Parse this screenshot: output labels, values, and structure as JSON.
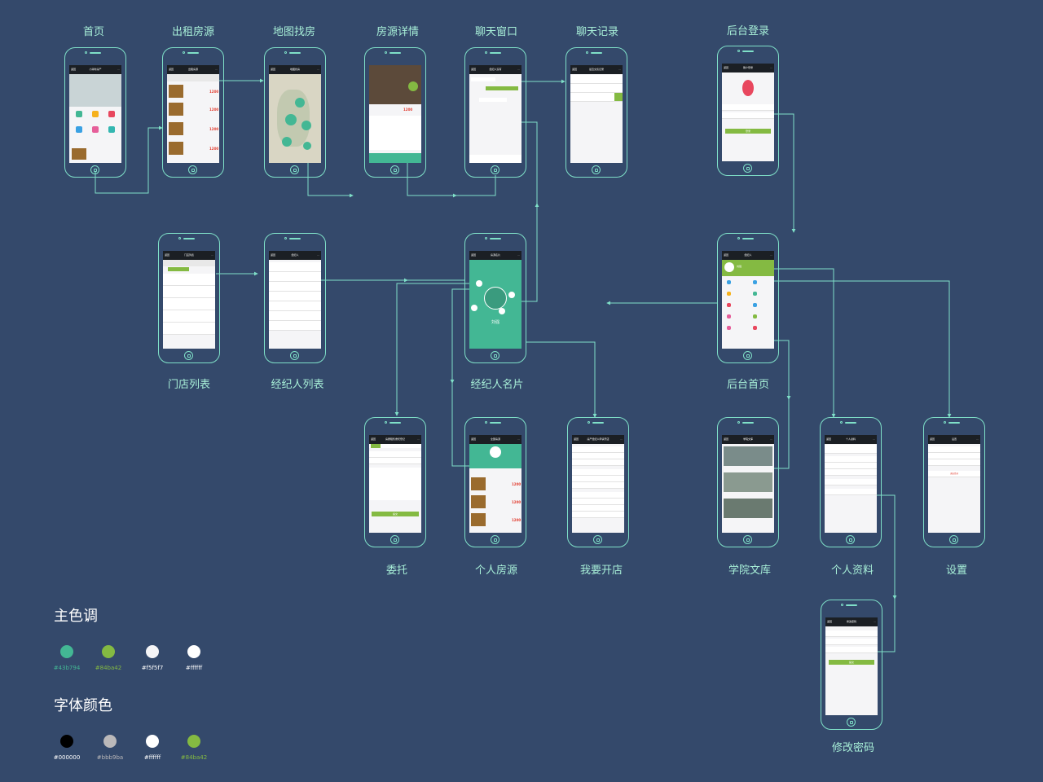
{
  "screens": [
    {
      "id": "home",
      "title": "首页",
      "nav": "小窝时房产"
    },
    {
      "id": "rent",
      "title": "出租房源",
      "nav": "出租房源"
    },
    {
      "id": "map",
      "title": "地图找房",
      "nav": "地图找房"
    },
    {
      "id": "detail",
      "title": "房源详情",
      "nav": ""
    },
    {
      "id": "chat",
      "title": "聊天窗口",
      "nav": "经纪人没有"
    },
    {
      "id": "chatlog",
      "title": "聊天记录",
      "nav": "最近交谈记录"
    },
    {
      "id": "login",
      "title": "后台登录",
      "nav": "账户登录"
    },
    {
      "id": "stores",
      "title": "门店列表",
      "nav": "门店列表"
    },
    {
      "id": "agents",
      "title": "经纪人列表",
      "nav": "经纪人"
    },
    {
      "id": "card",
      "title": "经纪人名片",
      "nav": "房源名片"
    },
    {
      "id": "dashboard",
      "title": "后台首页",
      "nav": "经纪人"
    },
    {
      "id": "entrust",
      "title": "委托",
      "nav": "房屋租售委托登记"
    },
    {
      "id": "mylist",
      "title": "个人房源",
      "nav": "全部房源"
    },
    {
      "id": "openstore",
      "title": "我要开店",
      "nav": "房产经纪人申请开店"
    },
    {
      "id": "library",
      "title": "学院文库",
      "nav": "学院文库"
    },
    {
      "id": "profile",
      "title": "个人资料",
      "nav": "个人资料"
    },
    {
      "id": "settings",
      "title": "设置",
      "nav": "设置"
    },
    {
      "id": "password",
      "title": "修改密码",
      "nav": "修改密码"
    }
  ],
  "legend": {
    "main_title": "主色调",
    "main_colors": [
      "#43b794",
      "#84ba42",
      "#f5f5f7",
      "#ffffff"
    ],
    "font_title": "字体颜色",
    "font_colors": [
      "#000000",
      "#bbb9ba",
      "#ffffff",
      "#84ba42"
    ]
  },
  "ui": {
    "back": "返回",
    "more": "···",
    "rent_price": "1200",
    "detail_price": "1200",
    "card_name": "刘强",
    "login_button": "登录",
    "entrust_button": "提交",
    "password_button": "提交",
    "logout": "退出登录",
    "dash_name": "刘强"
  }
}
